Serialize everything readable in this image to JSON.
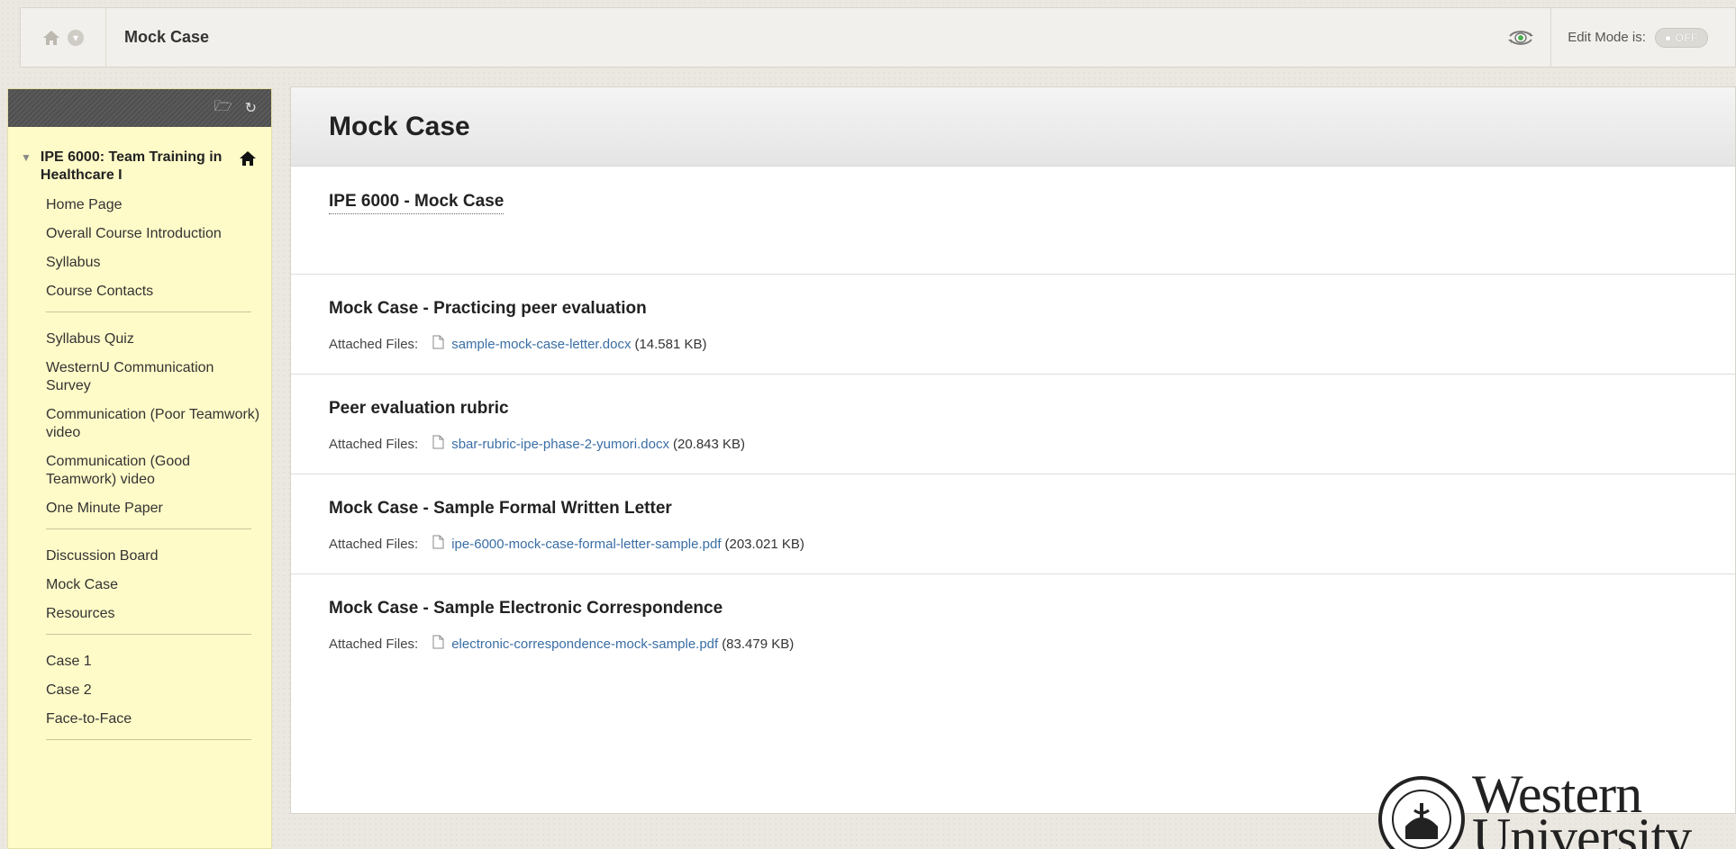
{
  "breadcrumb": {
    "title": "Mock Case",
    "edit_mode_label": "Edit Mode is:",
    "edit_mode_state": "OFF"
  },
  "sidebar": {
    "course_title": "IPE 6000: Team Training in Healthcare I",
    "groups": [
      [
        "Home Page",
        "Overall Course Introduction",
        "Syllabus",
        "Course Contacts"
      ],
      [
        "Syllabus Quiz",
        "WesternU Communication Survey",
        "Communication (Poor Teamwork) video",
        "Communication (Good Teamwork) video",
        "One Minute Paper"
      ],
      [
        "Discussion Board",
        "Mock Case",
        "Resources"
      ],
      [
        "Case 1",
        "Case 2",
        "Face-to-Face"
      ]
    ]
  },
  "content": {
    "heading": "Mock Case",
    "items": [
      {
        "title": "IPE 6000 - Mock Case"
      },
      {
        "title": "Mock Case - Practicing peer evaluation",
        "attached_label": "Attached Files:",
        "file_name": "sample-mock-case-letter.docx",
        "file_size": "(14.581 KB)"
      },
      {
        "title": "Peer evaluation rubric",
        "attached_label": "Attached Files:",
        "file_name": "sbar-rubric-ipe-phase-2-yumori.docx",
        "file_size": "(20.843 KB)"
      },
      {
        "title": "Mock Case - Sample Formal Written Letter",
        "attached_label": "Attached Files:",
        "file_name": "ipe-6000-mock-case-formal-letter-sample.pdf",
        "file_size": "(203.021 KB)"
      },
      {
        "title": "Mock Case - Sample Electronic Correspondence",
        "attached_label": "Attached Files:",
        "file_name": "electronic-correspondence-mock-sample.pdf",
        "file_size": "(83.479 KB)"
      }
    ]
  },
  "logo": {
    "line1": "Western",
    "line2": "University",
    "seal_text": "WESTERN UNIVERSITY"
  },
  "colors": {
    "sidebar_bg": "#fffbc8",
    "link": "#3a6ea5",
    "page_bg": "#ebe8e1"
  }
}
